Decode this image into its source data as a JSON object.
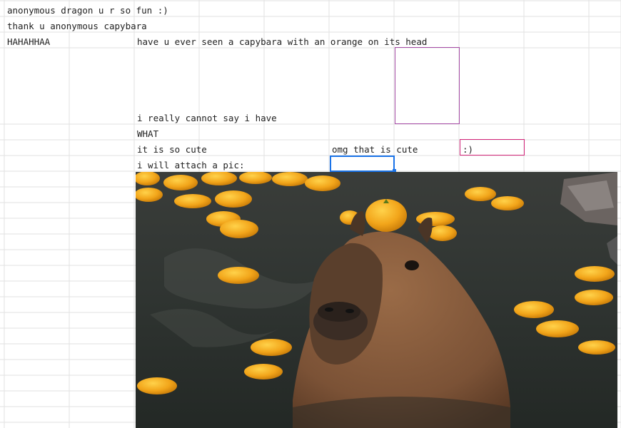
{
  "sheet": {
    "rows": [
      {
        "name": "cell-a1",
        "text": "anonymous dragon u r so fun :)"
      },
      {
        "name": "cell-a2",
        "text": "thank u anonymous capybara"
      },
      {
        "name": "cell-a3",
        "text": "HAHAHHAA"
      },
      {
        "name": "cell-c3",
        "text": "have u ever seen a capybara with an orange on its head"
      },
      {
        "name": "cell-c4",
        "text": "i really cannot say i have"
      },
      {
        "name": "cell-c5",
        "text": "WHAT"
      },
      {
        "name": "cell-c6",
        "text": "it is so cute"
      },
      {
        "name": "cell-f6",
        "text": "omg that is cute"
      },
      {
        "name": "cell-h6",
        "text": ":)"
      },
      {
        "name": "cell-c7",
        "text": "i will attach a pic:"
      }
    ]
  },
  "colors": {
    "gridline": "#e2e2e2",
    "selection": "#1a73e8",
    "comment_border_purple": "#a64ca6",
    "comment_border_pink": "#d4267a"
  },
  "image": {
    "icon": "capybara-with-orange-photo"
  }
}
